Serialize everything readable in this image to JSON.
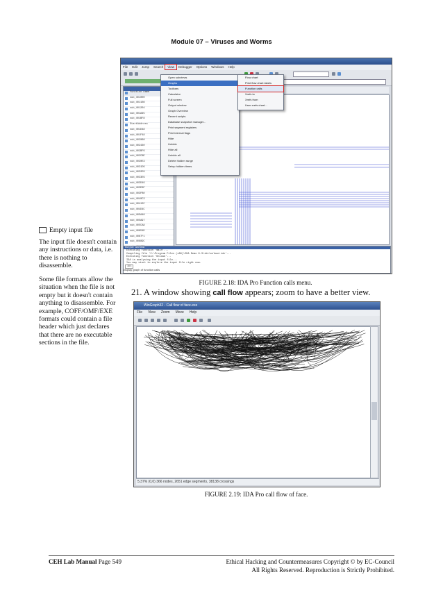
{
  "header": {
    "module_title": "Module 07 – Viruses and Worms"
  },
  "sidebar": {
    "note1_title": "Empty input file",
    "note1_body": "The input file doesn't contain any instructions or data, i.e. there is nothing to disassemble.",
    "note2": "Some file formats allow the situation when the file is not empty but it doesn't contain anything to disassemble. For example, COFF/OMF/EXE formats could contain a file header which just declares that there are no executable sections in the file."
  },
  "figure1": {
    "caption": "FIGURE 2.18: IDA Pro Function calls menu.",
    "menu": [
      "File",
      "Edit",
      "Jump",
      "Search",
      "View",
      "Debugger",
      "Options",
      "Windows",
      "Help"
    ],
    "view_menu": [
      "Open subviews",
      "Graphs",
      "Toolbars",
      "Calculator",
      "Full screen",
      "Output window",
      "Graph Overview",
      "Recent scripts",
      "Database snapshot manager...",
      "Print segment registers",
      "Print internal flags",
      "Hide",
      "Unhide",
      "Hide all",
      "Unhide all",
      "Delete hidden range",
      "Setup hidden items"
    ],
    "graphs_submenu": [
      "Flow chart",
      "Print flow chart labels",
      "Function calls",
      "Xrefs to",
      "Xrefs from",
      "User xrefs chart..."
    ],
    "highlighted_item": "Function calls",
    "functions_header": "Functions window",
    "function_column": "Function name",
    "functions": [
      "sub_401000",
      "sub_401108",
      "sub_401204",
      "sub_401A45",
      "sub_401BF8",
      "StartAddress",
      "sub_401D48",
      "sub_401F48",
      "sub_402068",
      "sub_402430",
      "sub_402BF9",
      "sub_402C8E",
      "sub_4030E3",
      "sub_4031D9",
      "sub_4032E9",
      "sub_4033E9",
      "sub_403D49",
      "sub_403E6F",
      "sub_403FB0",
      "sub_4040C3",
      "sub_40412C",
      "sub_404D4C",
      "sub_405A48",
      "sub_405A97",
      "sub_405CA8",
      "sub_40654D",
      "sub_4067F1",
      "sub_40689C",
      "sub_40A60D",
      "sub_40D6BB",
      "sub_40D8D3",
      "sub_40D99C",
      "sub_40FD65",
      "sub_41002A",
      "sub_4104F7",
      "sub_4107B1"
    ],
    "line_status": "Line 7 of 258",
    "output_header": "Output window",
    "output_lines": [
      "Executing function 'main'...",
      "Compiling file 'C:\\Program Files (x86)\\IDA Demo 6.3\\idc\\onload.idc'...",
      "Executing function 'OnLoad'...",
      "IDA is analysing the input file...",
      "You may start to explore the input file right now."
    ],
    "idc_label": "IDC",
    "status_bar": "Display graph of function calls"
  },
  "step21": {
    "number": "21.",
    "before": "A window showing ",
    "bold": "call flow",
    "after": " appears; zoom to have a better view."
  },
  "figure2": {
    "caption": "FIGURE 2.19: IDA Pro call flow of face.",
    "title": "WinGraph32 - Call flow of face.exe",
    "menu": [
      "File",
      "View",
      "Zoom",
      "Move",
      "Help"
    ],
    "status": "5.37% (0,0) 366 nodes, 2651 edge segments, 38138 crossings"
  },
  "footer": {
    "left_bold": "CEH Lab Manual",
    "left_page": " Page 549",
    "right_line1": "Ethical Hacking and Countermeasures Copyright © by EC-Council",
    "right_line2": "All Rights Reserved. Reproduction is Strictly Prohibited."
  }
}
